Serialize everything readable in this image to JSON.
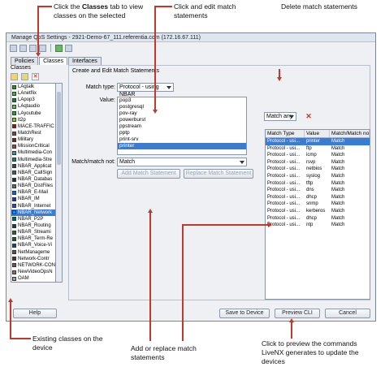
{
  "callouts": {
    "classes_tab": {
      "pre": "Click the ",
      "bold": "Classes",
      "post": " tab to view classes on the selected"
    },
    "edit_match": "Click and edit match statements",
    "delete_match": "Delete match statements",
    "existing_classes": "Existing classes on the device",
    "add_replace": "Add or replace match statements",
    "preview": "Click to preview the commands LiveNX generates to update the devices"
  },
  "window": {
    "title": "Manage QoS Settings - 2921-Demo-67_111.referentia.com (172.16.67.111)",
    "tabs": [
      "Policies",
      "Classes",
      "Interfaces"
    ],
    "active_tab": "Classes"
  },
  "left_pane": {
    "title": "Classes",
    "classes": [
      {
        "name": "LAgtalk",
        "color": "#2e8b3a"
      },
      {
        "name": "LAnetflix",
        "color": "#4caf50"
      },
      {
        "name": "LApop3",
        "color": "#1f7a33"
      },
      {
        "name": "LAqtaudio",
        "color": "#66bb6a"
      },
      {
        "name": "LAyoutube",
        "color": "#2f9e44"
      },
      {
        "name": "lt2p",
        "color": "#8bc34a"
      },
      {
        "name": "MACE-TRAFFIC",
        "color": "#8b1a1a"
      },
      {
        "name": "MatchRest",
        "color": "#b03030"
      },
      {
        "name": "Military",
        "color": "#7a2020"
      },
      {
        "name": "MissionCritical",
        "color": "#c0392b"
      },
      {
        "name": "Multimedia-Con",
        "color": "#26a69a"
      },
      {
        "name": "Multimedia-Stre",
        "color": "#00897b"
      },
      {
        "name": "NBAR_Applicat",
        "color": "#37474f"
      },
      {
        "name": "NBAR_CallSign",
        "color": "#455a64"
      },
      {
        "name": "NBAR_Databas",
        "color": "#263238"
      },
      {
        "name": "NBAR_DistFiles",
        "color": "#546e7a"
      },
      {
        "name": "NBAR_E-Mail",
        "color": "#1565c0"
      },
      {
        "name": "NBAR_IM",
        "color": "#283593"
      },
      {
        "name": "NBAR_Internet",
        "color": "#3949ab"
      },
      {
        "name": "NBAR_Network",
        "color": "#1e88e5"
      },
      {
        "name": "NBAR_P2P",
        "color": "#00695c"
      },
      {
        "name": "NBAR_Routing",
        "color": "#004d40"
      },
      {
        "name": "NBAR_Streami",
        "color": "#33691e"
      },
      {
        "name": "NBAR_Term-Re",
        "color": "#1b5e20"
      },
      {
        "name": "NBAR_Voice-Vi",
        "color": "#0d47a1"
      },
      {
        "name": "NetManageme",
        "color": "#6d4c41"
      },
      {
        "name": "Network-Contr",
        "color": "#4e342e"
      },
      {
        "name": "NETWORK-CON",
        "color": "#795548"
      },
      {
        "name": "NewVideoOpsN",
        "color": "#8d6e63"
      },
      {
        "name": "OAM",
        "color": "#9e9e9e"
      }
    ],
    "selected_index": 19
  },
  "right_pane": {
    "title": "Create and Edit Match Statements",
    "match_type_label": "Match type:",
    "match_type_value": "Protocol - using NBAR",
    "value_label": "Value:",
    "values": [
      "pop3",
      "postgresql",
      "pov-ray",
      "powerburst",
      "ppstream",
      "pptp",
      "print-srv",
      "printer"
    ],
    "selected_value": "printer",
    "match_not_label": "Match/match not:",
    "match_not_value": "Match",
    "add_button": "Add Match Statement",
    "replace_button": "Replace Match Statement",
    "match_any": "Match any",
    "table": {
      "headers": [
        "Match Type",
        "Value",
        "Match/Match not"
      ],
      "rows": [
        [
          "Protocol - usi...",
          "printer",
          "Match"
        ],
        [
          "Protocol - usi...",
          "ftp",
          "Match"
        ],
        [
          "Protocol - usi...",
          "icmp",
          "Match"
        ],
        [
          "Protocol - usi...",
          "rsvp",
          "Match"
        ],
        [
          "Protocol - usi...",
          "netbios",
          "Match"
        ],
        [
          "Protocol - usi...",
          "syslog",
          "Match"
        ],
        [
          "Protocol - usi...",
          "tftp",
          "Match"
        ],
        [
          "Protocol - usi...",
          "dns",
          "Match"
        ],
        [
          "Protocol - usi...",
          "dhcp",
          "Match"
        ],
        [
          "Protocol - usi...",
          "snmp",
          "Match"
        ],
        [
          "Protocol - usi...",
          "kerberos",
          "Match"
        ],
        [
          "Protocol - usi...",
          "dhcp",
          "Match"
        ],
        [
          "Protocol - usi...",
          "ntp",
          "Match"
        ]
      ],
      "selected_index": 0
    }
  },
  "bottom": {
    "help": "Help",
    "save": "Save to Device",
    "preview": "Preview CLI",
    "cancel": "Cancel"
  }
}
